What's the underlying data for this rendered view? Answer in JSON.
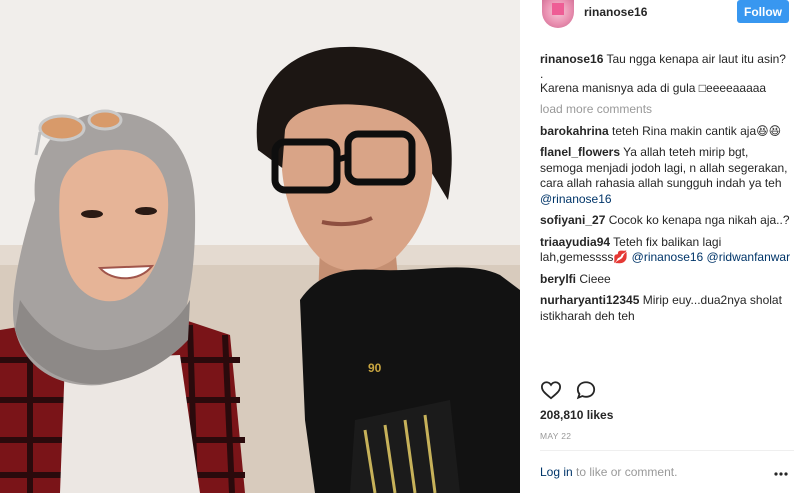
{
  "header": {
    "username": "rinanose16",
    "follow_label": "Follow"
  },
  "caption": {
    "username": "rinanose16",
    "text": "Tau ngga kenapa air laut itu asin?",
    "dot": ".",
    "text2": "Karena manisnya ada di gula □eeeeaaaaa"
  },
  "load_more": "load more comments",
  "comments": [
    {
      "user": "barokahrina",
      "text": "teteh Rina makin cantik aja😆😆",
      "mention": ""
    },
    {
      "user": "flanel_flowers",
      "text": "Ya allah teteh mirip bgt, semoga menjadi jodoh lagi, n allah segerakan, cara allah rahasia allah sungguh indah ya teh",
      "mention": "@rinanose16"
    },
    {
      "user": "sofiyani_27",
      "text": "Cocok ko kenapa nga nikah aja..?",
      "mention": ""
    },
    {
      "user": "triaayudia94",
      "text": "Teteh fix balikan lagi lah,gemessss💋",
      "mention": "@rinanose16 @ridwanfanwar"
    },
    {
      "user": "berylfi",
      "text": "Cieee",
      "mention": ""
    },
    {
      "user": "nurharyanti12345",
      "text": "Mirip euy...dua2nya sholat istikharah deh teh",
      "mention": ""
    }
  ],
  "likes": "208,810 likes",
  "date": "MAY 22",
  "login": {
    "link": "Log in",
    "rest": " to like or comment."
  },
  "icons": {
    "like": "heart-icon",
    "comment": "comment-icon",
    "more": "more-options-icon"
  },
  "colors": {
    "follow_button": "#3897f0",
    "link": "#003569",
    "muted": "#999999"
  }
}
